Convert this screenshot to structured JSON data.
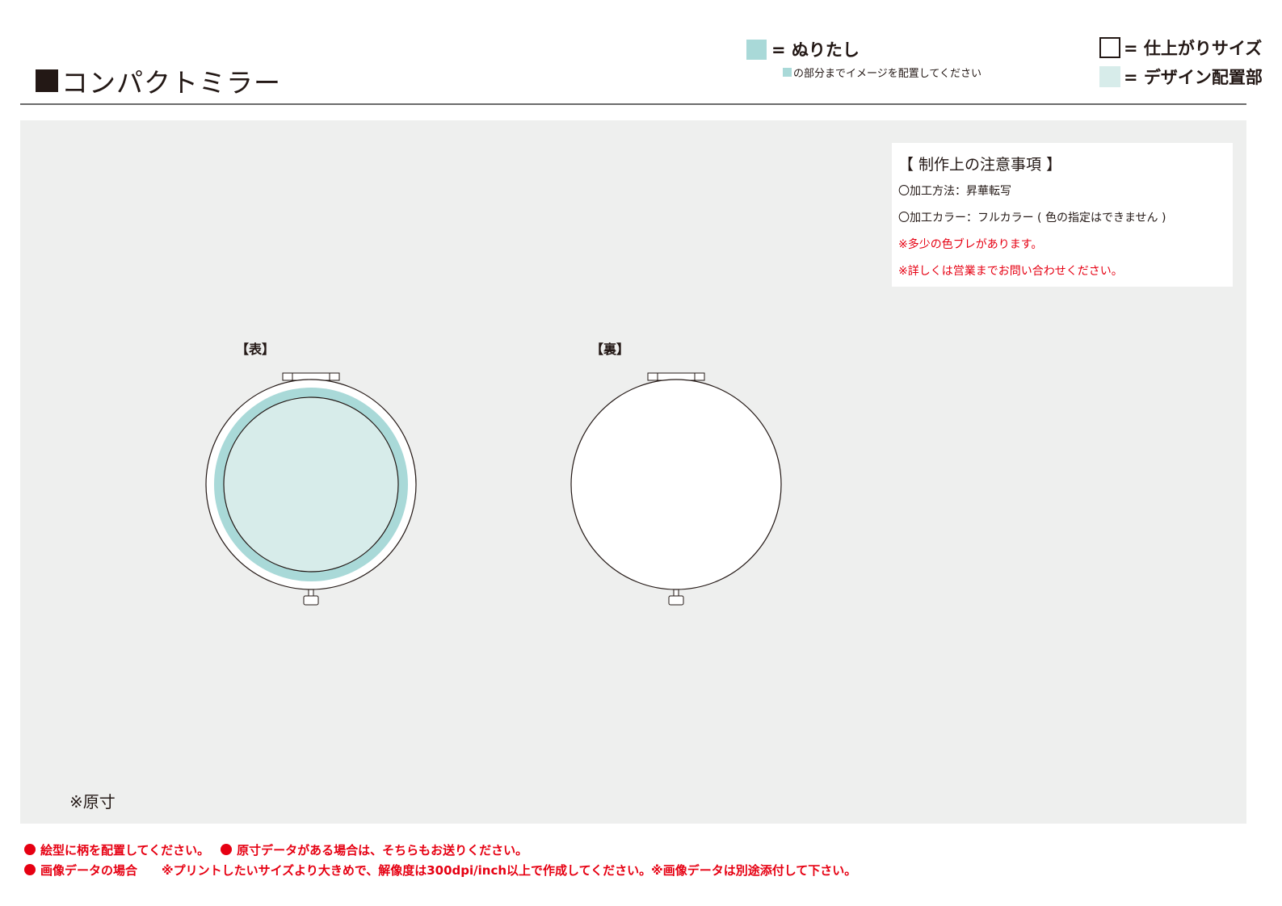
{
  "header": {
    "title": "コンパクトミラー"
  },
  "legend": {
    "bleed_label": "= ぬりたし",
    "bleed_note": "の部分までイメージを配置してください",
    "finish_label": "= 仕上がりサイズ",
    "design_label": "= デザイン配置部",
    "colors": {
      "bleed": "#a9d9d8",
      "design": "#d7ecea",
      "canvas": "#eeefee",
      "red": "#e60012"
    }
  },
  "notes": {
    "heading": "【 制作上の注意事項 】",
    "method": "〇加工方法：昇華転写",
    "color": "〇加工カラー：フルカラー ( 色の指定はできません )",
    "warning1": "※多少の色ブレがあります。",
    "warning2": "※詳しくは営業までお問い合わせください。"
  },
  "faces": {
    "front_label": "【表】",
    "back_label": "【裏】"
  },
  "scale_note": "※原寸",
  "footer": {
    "line1_a": "絵型に柄を配置してください。",
    "line1_b": "原寸データがある場合は、そちらもお送りください。",
    "line2_a": "画像データの場合",
    "line2_b": "※プリントしたいサイズより大きめで、解像度は300dpi/inch以上で作成してください。※画像データは別途添付して下さい。"
  }
}
